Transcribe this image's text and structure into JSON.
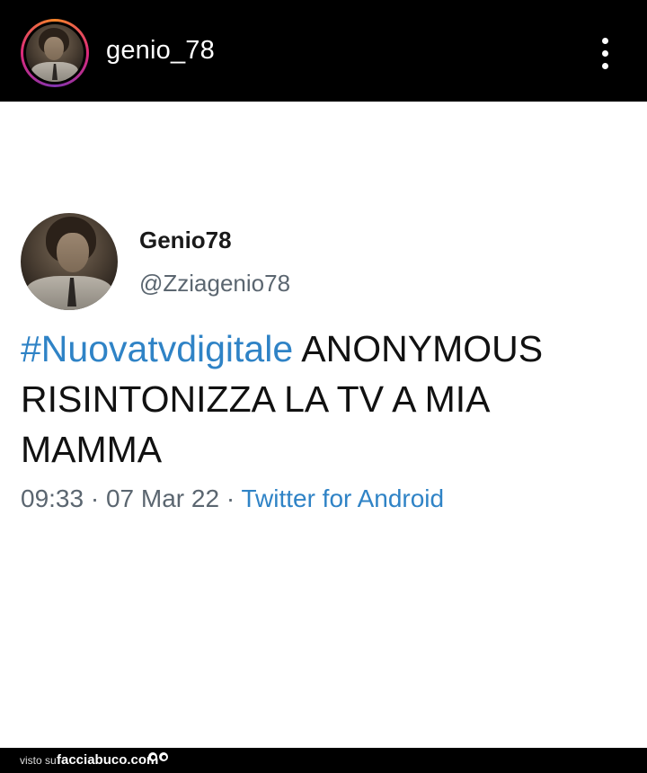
{
  "header": {
    "username": "genio_78",
    "avatar_icon": "profile-photo",
    "menu_icon": "more-vertical-icon"
  },
  "tweet": {
    "display_name": "Genio78",
    "handle": "@Zziagenio78",
    "hashtag": "#Nuovatvdigitale",
    "text": " ANONYMOUS RISINTONIZZA LA TV A MIA MAMMA",
    "time": "09:33",
    "date": "07 Mar 22",
    "separator": " · ",
    "source": "Twitter for Android",
    "accent_color": "#2f83c6"
  },
  "footer": {
    "prefix": "visto su",
    "site": "facciabuco.com"
  }
}
